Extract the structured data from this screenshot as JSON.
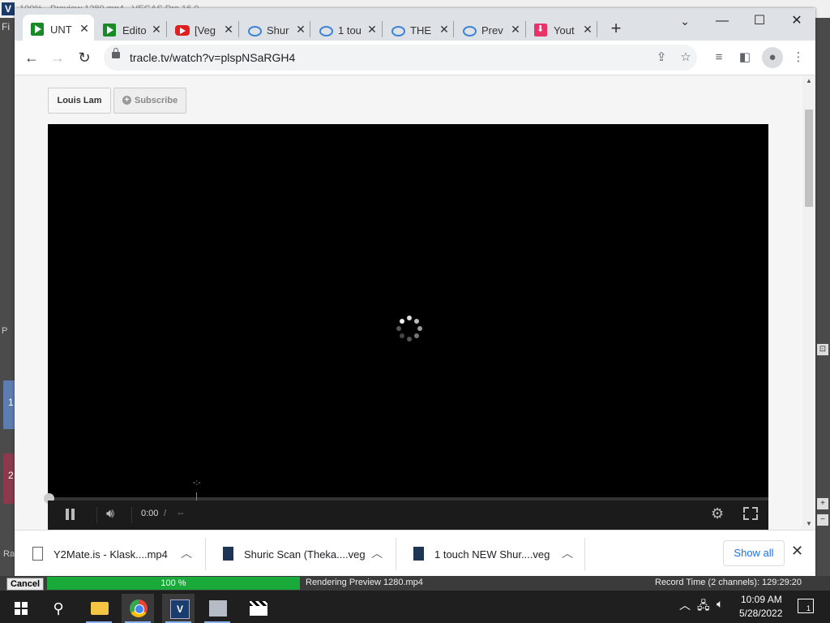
{
  "vegas": {
    "logo": "V",
    "title_fragment": "100% - Preview 1280.mp4 - VEGAS Pro 16.0",
    "left_menu_fragment": "Fi",
    "track1_num": "1",
    "track2_num": "2",
    "left_label_p": "P",
    "left_label_ra": "Ra",
    "cancel_label": "Cancel",
    "progress_percent": 100,
    "progress_label": "100 %",
    "render_status": "Rendering Preview 1280.mp4",
    "record_time": "Record Time (2 channels): 129:29:20"
  },
  "browser": {
    "tabs": [
      {
        "title": "UNT",
        "icon": "play-icon",
        "color": "#1a8a26",
        "active": true
      },
      {
        "title": "Edito",
        "icon": "play-icon",
        "color": "#1a8a26",
        "active": false
      },
      {
        "title": "[Veg",
        "icon": "youtube-icon",
        "color": "#e02020",
        "active": false
      },
      {
        "title": "Shur",
        "icon": "tracle-icon",
        "color": "#3e84d6",
        "active": false
      },
      {
        "title": "1 tou",
        "icon": "tracle-icon",
        "color": "#3e84d6",
        "active": false
      },
      {
        "title": "THE",
        "icon": "tracle-icon",
        "color": "#3e84d6",
        "active": false
      },
      {
        "title": "Prev",
        "icon": "tracle-icon",
        "color": "#3e84d6",
        "active": false
      },
      {
        "title": "Yout",
        "icon": "download-icon",
        "color": "#e8336b",
        "active": false
      }
    ],
    "url": "tracle.tv/watch?v=plspNSaRGH4"
  },
  "page": {
    "channel_name": "Louis Lam",
    "subscribe_label": "Subscribe",
    "player": {
      "current_time": "0:00",
      "time_separator": "/",
      "total_time": "--",
      "cursor_text": "-:-",
      "progress": 0,
      "state": "loading"
    }
  },
  "downloads": {
    "items": [
      {
        "name": "Y2Mate.is - Klask....mp4",
        "icon": "file-icon"
      },
      {
        "name": "Shuric Scan (Theka....veg",
        "icon": "vegas-file-icon"
      },
      {
        "name": "1 touch NEW Shur....veg",
        "icon": "vegas-file-icon"
      }
    ],
    "show_all_label": "Show all"
  },
  "taskbar": {
    "time": "10:09 AM",
    "date": "5/28/2022",
    "notification_count": "1",
    "vegas_letter": "V"
  }
}
